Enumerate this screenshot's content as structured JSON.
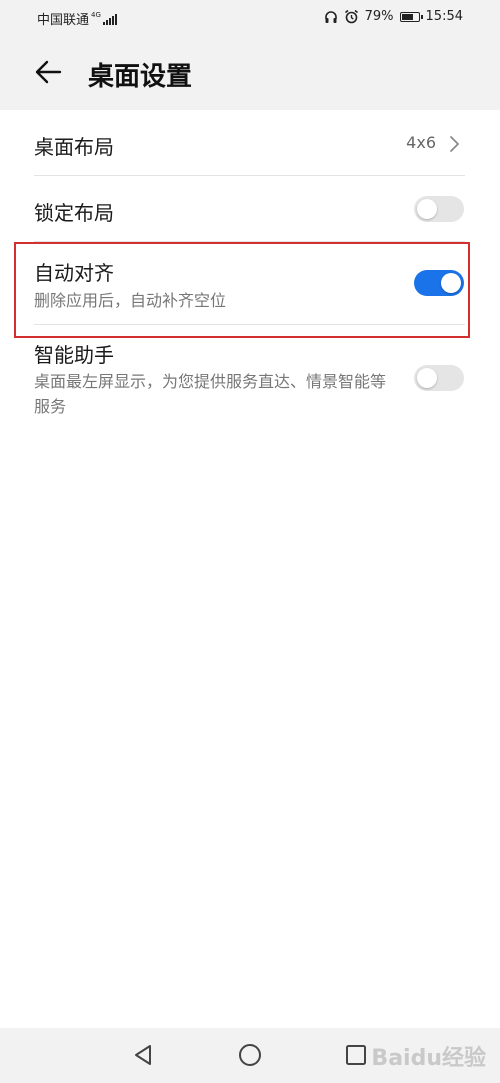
{
  "status_bar": {
    "carrier": "中国联通",
    "network": "4G",
    "battery_percent": "79%",
    "battery_level": 0.79,
    "time": "15:54",
    "icons": [
      "headset-icon",
      "alarm-icon"
    ]
  },
  "header": {
    "title": "桌面设置",
    "back_icon": "back-arrow-icon"
  },
  "settings": {
    "layout": {
      "label": "桌面布局",
      "value": "4x6"
    },
    "lock_layout": {
      "label": "锁定布局",
      "enabled": false
    },
    "auto_align": {
      "label": "自动对齐",
      "description": "删除应用后，自动补齐空位",
      "enabled": true
    },
    "smart_assistant": {
      "label": "智能助手",
      "description": "桌面最左屏显示，为您提供服务直达、情景智能等服务",
      "enabled": false
    }
  },
  "nav_bar": {
    "buttons": [
      "back-triangle-icon",
      "home-circle-icon",
      "recents-square-icon"
    ]
  },
  "colors": {
    "accent": "#1a73e8",
    "highlight": "#d32f2f",
    "header_bg": "#f2f2f2"
  },
  "watermark": "Baidu经验"
}
